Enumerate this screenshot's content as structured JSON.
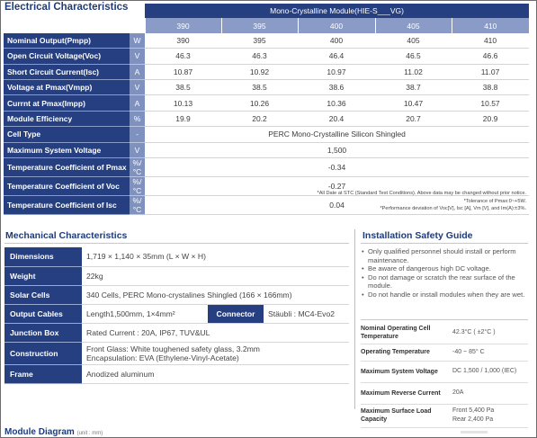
{
  "electrical": {
    "title": "Electrical Characteristics",
    "module_header": "Mono-Crystalline Module(HIE-S___VG)",
    "powers": [
      "390",
      "395",
      "400",
      "405",
      "410"
    ],
    "rows": [
      {
        "label": "Nominal Output(Pmpp)",
        "unit": "W",
        "values": [
          "390",
          "395",
          "400",
          "405",
          "410"
        ]
      },
      {
        "label": "Open Circuit Voltage(Voc)",
        "unit": "V",
        "values": [
          "46.3",
          "46.3",
          "46.4",
          "46.5",
          "46.6"
        ]
      },
      {
        "label": "Short Circuit Current(Isc)",
        "unit": "A",
        "values": [
          "10.87",
          "10.92",
          "10.97",
          "11.02",
          "11.07"
        ]
      },
      {
        "label": "Voltage at Pmax(Vmpp)",
        "unit": "V",
        "values": [
          "38.5",
          "38.5",
          "38.6",
          "38.7",
          "38.8"
        ]
      },
      {
        "label": "Currnt at Pmax(Impp)",
        "unit": "A",
        "values": [
          "10.13",
          "10.26",
          "10.36",
          "10.47",
          "10.57"
        ]
      },
      {
        "label": "Module Efficiency",
        "unit": "%",
        "values": [
          "19.9",
          "20.2",
          "20.4",
          "20.7",
          "20.9"
        ]
      }
    ],
    "span_rows": [
      {
        "label": "Cell Type",
        "unit": "-",
        "value": "PERC Mono-Crystalline Silicon Shingled"
      },
      {
        "label": "Maximum System Voltage",
        "unit": "V",
        "value": "1,500"
      },
      {
        "label": "Temperature Coefficient of Pmax",
        "unit": "%/°C",
        "value": "-0.34"
      },
      {
        "label": "Temperature Coefficient of Voc",
        "unit": "%/°C",
        "value": "-0.27"
      },
      {
        "label": "Temperature Coefficient of Isc",
        "unit": "%/°C",
        "value": "0.04"
      }
    ],
    "notes": [
      "*All Date at STC (Standard Test Conditions). Above data may be changed without prior notice.",
      "*Tolerance of Pmax:0~+5W.",
      "*Performance deviation of Voc[V], Isc [A], Vm [V], and Im(A):±3%."
    ]
  },
  "mechanical": {
    "title": "Mechanical Characteristics",
    "dimensions_label": "Dimensions",
    "dimensions_value": "1,719 × 1,140 × 35mm (L × W × H)",
    "weight_label": "Weight",
    "weight_value": "22kg",
    "solar_cells_label": "Solar Cells",
    "solar_cells_value": "340 Cells, PERC Mono-crystalines Shingled (166 × 166mm)",
    "output_cables_label": "Output Cables",
    "output_cables_value": "Length1,500mm, 1×4mm²",
    "connector_label": "Connector",
    "connector_value": "Stäubli : MC4-Evo2",
    "junction_box_label": "Junction Box",
    "junction_box_value": "Rated Current : 20A, IP67, TUV&UL",
    "construction_label": "Construction",
    "construction_line1": "Front Glass: White toughened safety glass, 3.2mm",
    "construction_line2": "Encapsulation: EVA (Ethylene-Vinyl-Acetate)",
    "frame_label": "Frame",
    "frame_value": "Anodized aluminum"
  },
  "safety": {
    "title": "Installation Safety Guide",
    "bullets": [
      "Only qualified personnel should install or perform maintenance.",
      "Be aware of dangerous high DC voltage.",
      "Do not damage or scratch the rear surface of the module.",
      "Do not handle or install modules when they are wet."
    ],
    "specs": [
      {
        "label": "Nominal Operating Cell Temperature",
        "value": "42.3°C ( ±2°C )"
      },
      {
        "label": "Operating Temperature",
        "value": "-40 ~ 85° C"
      },
      {
        "label": "Maximum System Voltage",
        "value": "DC 1,500 / 1,000 (IEC)"
      },
      {
        "label": "Maximum Reverse Current",
        "value": "20A"
      },
      {
        "label": "Maximum Surface Load Capacity",
        "value_line1": "Front 5,400 Pa",
        "value_line2": "Rear 2,400 Pa"
      }
    ]
  },
  "diagram": {
    "title": "Module Diagram",
    "unit": "(unit : mm)"
  }
}
